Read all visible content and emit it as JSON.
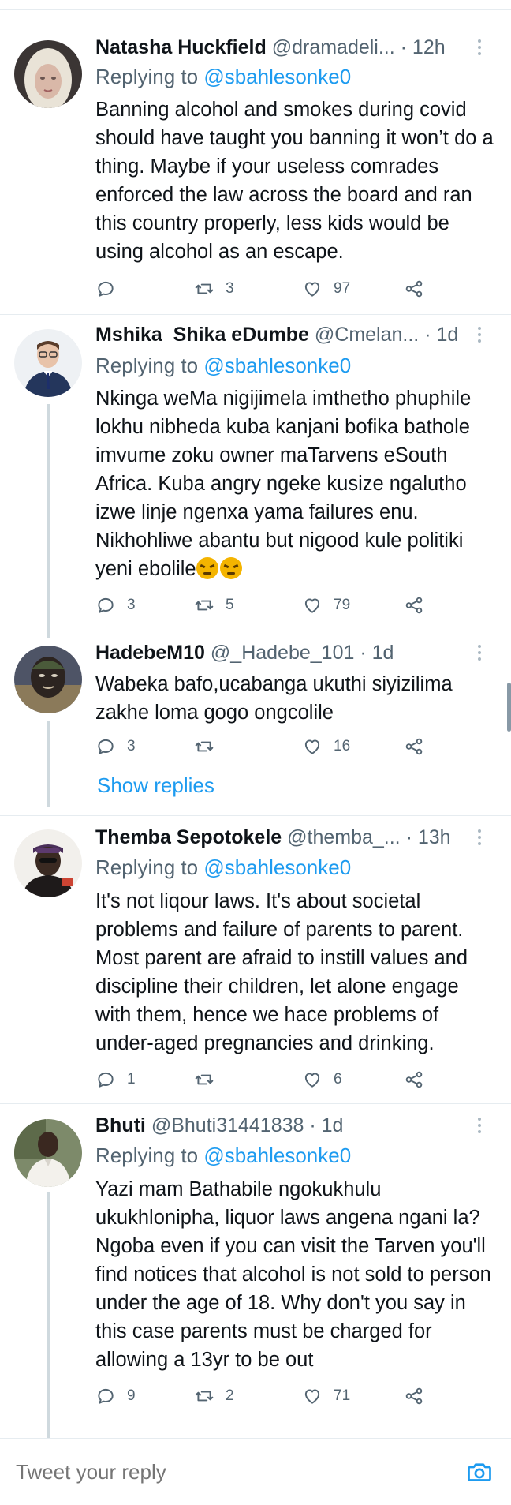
{
  "reply_prefix": "Replying to",
  "tweets": [
    {
      "name": "Natasha Huckfield",
      "handle": "@dramadeli...",
      "time": "· 12h",
      "replying_to": "@sbahlesonke0",
      "text": "Banning alcohol and smokes during covid should have taught you banning it won’t do a thing. Maybe if your useless comrades enforced the law across the board and ran this country properly, less kids would be using alcohol as an escape.",
      "replies": "",
      "retweets": "3",
      "likes": "97"
    },
    {
      "name": "Mshika_Shika eDumbe",
      "handle": "@Cmelan...",
      "time": "· 1d",
      "replying_to": "@sbahlesonke0",
      "text": "Nkinga weMa nigijimela imthetho phuphile lokhu nibheda kuba kanjani bofika bathole imvume zoku owner maTarvens eSouth Africa. Kuba angry ngeke kusize ngalutho izwe linje ngenxa yama failures enu. Nikhohliwe abantu but nigood kule politiki yeni ebolile",
      "replies": "3",
      "retweets": "5",
      "likes": "79"
    },
    {
      "name": "HadebeM10",
      "handle": "@_Hadebe_101",
      "time": "· 1d",
      "text": "Wabeka bafo,ucabanga ukuthi siyizilima zakhe loma gogo ongcolile",
      "replies": "3",
      "retweets": "",
      "likes": "16"
    },
    {
      "name": "Themba Sepotokele",
      "handle": "@themba_...",
      "time": "· 13h",
      "replying_to": "@sbahlesonke0",
      "text": "It's not liqour laws. It's about societal problems and failure of parents to parent. Most parent are afraid to instill values and discipline their children, let alone engage with them, hence we hace problems of under-aged pregnancies and drinking.",
      "replies": "1",
      "retweets": "",
      "likes": "6"
    },
    {
      "name": "Bhuti",
      "handle": "@Bhuti31441838",
      "time": "· 1d",
      "replying_to": "@sbahlesonke0",
      "text": "Yazi mam Bathabile ngokukhulu ukukhlonipha, liquor laws angena ngani la? Ngoba even if you can visit the Tarven you'll find notices that alcohol is not sold to person under the age of 18. Why don't you say in this case parents must be charged for allowing a 13yr to be out",
      "replies": "9",
      "retweets": "2",
      "likes": "71"
    }
  ],
  "show_replies_label": "Show replies",
  "composer": {
    "placeholder": "Tweet your reply"
  },
  "icons": {
    "reply": "reply-icon",
    "retweet": "retweet-icon",
    "like": "heart-icon",
    "share": "share-icon",
    "camera": "camera-icon",
    "more": "more-vertical-icon"
  },
  "colors": {
    "accent": "#1d9bf0",
    "muted": "#536471",
    "text": "#0f1419",
    "divider": "#e6ecf0"
  }
}
